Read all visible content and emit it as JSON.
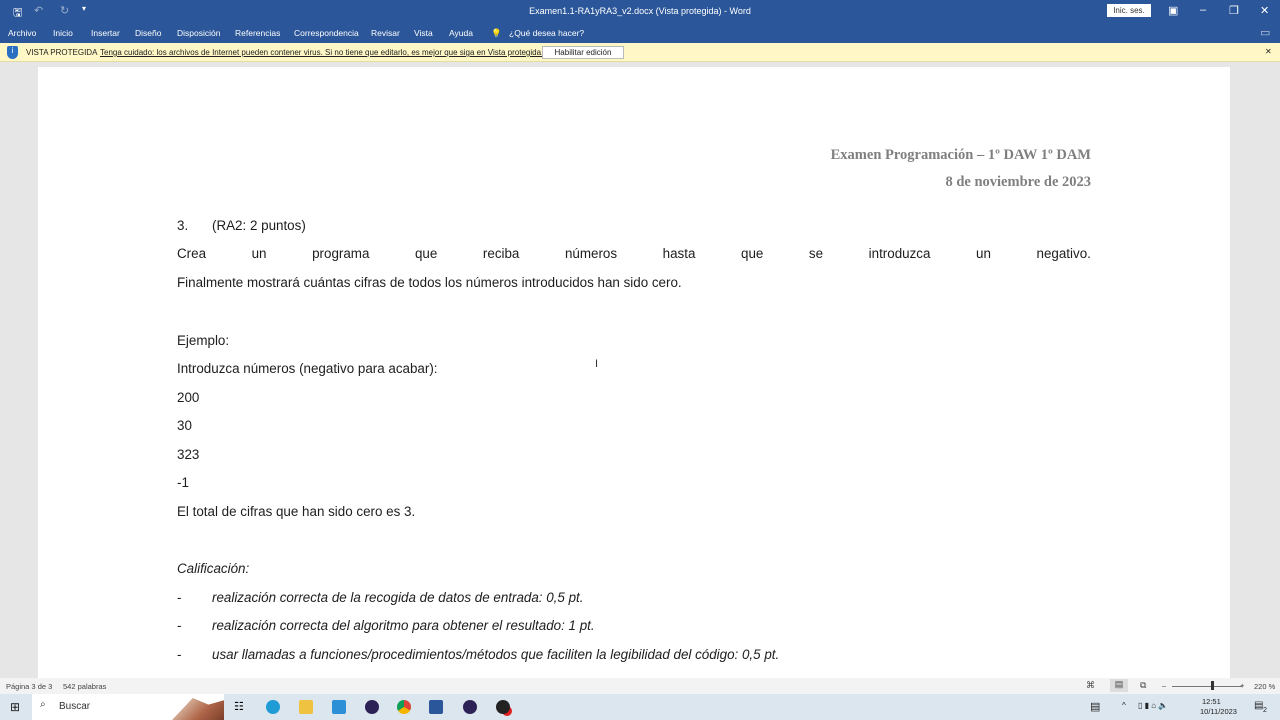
{
  "titlebar": {
    "title": "Examen1.1-RA1yRA3_v2.docx (Vista protegida)  -  Word",
    "signin": "Inic. ses."
  },
  "ribbon": {
    "tabs": [
      "Archivo",
      "Inicio",
      "Insertar",
      "Diseño",
      "Disposición",
      "Referencias",
      "Correspondencia",
      "Revisar",
      "Vista",
      "Ayuda"
    ],
    "tell_me": "¿Qué desea hacer?"
  },
  "protected": {
    "label": "VISTA PROTEGIDA",
    "message": "Tenga cuidado: los archivos de Internet pueden contener virus. Si no tiene que editarlo, es mejor que siga en Vista protegida.",
    "enable_button": "Habilitar edición"
  },
  "document": {
    "header_line1": "Examen Programación – 1º DAW 1º DAM",
    "header_line2": "8 de noviembre de 2023",
    "q_number": "3.",
    "q_points": "(RA2: 2 puntos)",
    "para_line1_words": [
      "Crea",
      "un",
      "programa",
      "que",
      "reciba",
      "números",
      "hasta",
      "que",
      "se",
      "introduzca",
      "un",
      "negativo."
    ],
    "para_line2": "Finalmente mostrará cuántas cifras de todos los números introducidos han sido cero.",
    "example_label": "Ejemplo:",
    "example_lines": [
      "Introduzca números (negativo para acabar):",
      "200",
      "30",
      "323",
      "-1",
      "El total de cifras que han sido cero es 3."
    ],
    "grading_label": "Calificación:",
    "grading_items": [
      "realización correcta de la recogida de  datos de entrada: 0,5 pt.",
      "realización correcta del algoritmo para obtener el resultado: 1 pt.",
      "usar llamadas a funciones/procedimientos/métodos que faciliten la legibilidad del código: 0,5 pt."
    ],
    "bullet": "-"
  },
  "status": {
    "page": "Página 3 de 3",
    "words": "542 palabras",
    "zoom": "220 %",
    "zoom_level_percent": 220
  },
  "taskbar": {
    "search": "Buscar",
    "time": "12:51",
    "date": "10/11/2023",
    "notifications": "2"
  }
}
